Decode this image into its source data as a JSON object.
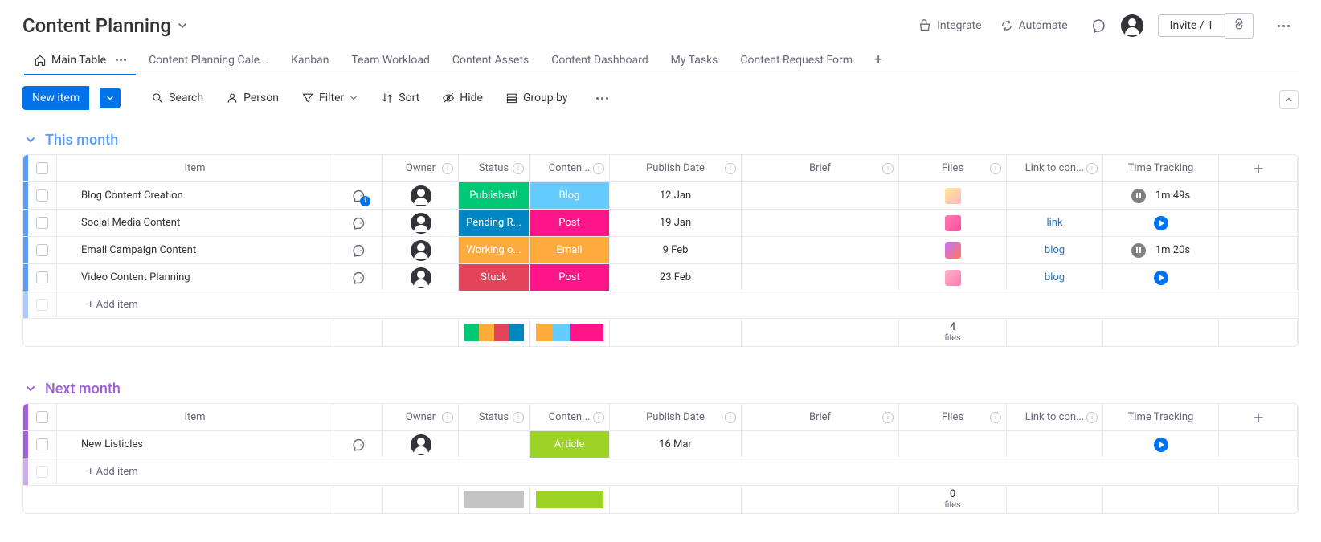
{
  "board": {
    "title": "Content Planning"
  },
  "headerActions": {
    "integrate": "Integrate",
    "automate": "Automate",
    "invite": "Invite / 1"
  },
  "tabs": [
    {
      "label": "Main Table",
      "icon": "home",
      "active": true
    },
    {
      "label": "Content Planning Cale..."
    },
    {
      "label": "Kanban"
    },
    {
      "label": "Team Workload"
    },
    {
      "label": "Content Assets"
    },
    {
      "label": "Content Dashboard"
    },
    {
      "label": "My Tasks"
    },
    {
      "label": "Content Request Form"
    }
  ],
  "toolbar": {
    "newItem": "New item",
    "search": "Search",
    "person": "Person",
    "filter": "Filter",
    "sort": "Sort",
    "hide": "Hide",
    "groupBy": "Group by"
  },
  "columns": {
    "item": "Item",
    "owner": "Owner",
    "status": "Status",
    "content": "Conten...",
    "publish": "Publish Date",
    "brief": "Brief",
    "files": "Files",
    "link": "Link to con...",
    "time": "Time Tracking"
  },
  "groups": [
    {
      "title": "This month",
      "colorClass": "blue",
      "titleClass": "g-blue",
      "items": [
        {
          "name": "Blog Content Creation",
          "commentCount": "1",
          "status": {
            "text": "Published!",
            "cls": "s-published"
          },
          "content": {
            "text": "Blog",
            "cls": "ct-blog"
          },
          "publish": "12 Jan",
          "fileCls": "thumb-0",
          "link": "",
          "time": {
            "state": "pause",
            "label": "1m 49s"
          }
        },
        {
          "name": "Social Media Content",
          "commentCount": "",
          "status": {
            "text": "Pending R...",
            "cls": "s-pending"
          },
          "content": {
            "text": "Post",
            "cls": "ct-post"
          },
          "publish": "19 Jan",
          "fileCls": "thumb-1",
          "link": "link",
          "time": {
            "state": "play",
            "label": ""
          }
        },
        {
          "name": "Email Campaign Content",
          "commentCount": "",
          "status": {
            "text": "Working o...",
            "cls": "s-working"
          },
          "content": {
            "text": "Email",
            "cls": "ct-email"
          },
          "publish": "9 Feb",
          "fileCls": "thumb-2",
          "link": "blog",
          "time": {
            "state": "pause",
            "label": "1m 20s"
          }
        },
        {
          "name": "Video Content Planning",
          "commentCount": "",
          "status": {
            "text": "Stuck",
            "cls": "s-stuck"
          },
          "content": {
            "text": "Post",
            "cls": "ct-post"
          },
          "publish": "23 Feb",
          "fileCls": "thumb-3",
          "link": "blog",
          "time": {
            "state": "play",
            "label": ""
          }
        }
      ],
      "addText": "+ Add item",
      "summary": {
        "statusColors": [
          "#00c875",
          "#fdab3d",
          "#e2445c",
          "#0086c0"
        ],
        "contentColors": [
          "#fdab3d",
          "#66ccff",
          "#ff158a",
          "#ff158a"
        ],
        "filesCount": "4",
        "filesLabel": "files"
      }
    },
    {
      "title": "Next month",
      "colorClass": "purple",
      "titleClass": "g-purple",
      "items": [
        {
          "name": "New Listicles",
          "commentCount": "",
          "status": {
            "text": "",
            "cls": ""
          },
          "content": {
            "text": "Article",
            "cls": "ct-article"
          },
          "publish": "16 Mar",
          "fileCls": "",
          "link": "",
          "time": {
            "state": "play",
            "label": ""
          }
        }
      ],
      "addText": "+ Add item",
      "summary": {
        "statusColors": [
          "#c4c4c4"
        ],
        "contentColors": [
          "#9cd326"
        ],
        "filesCount": "0",
        "filesLabel": "files"
      }
    }
  ]
}
